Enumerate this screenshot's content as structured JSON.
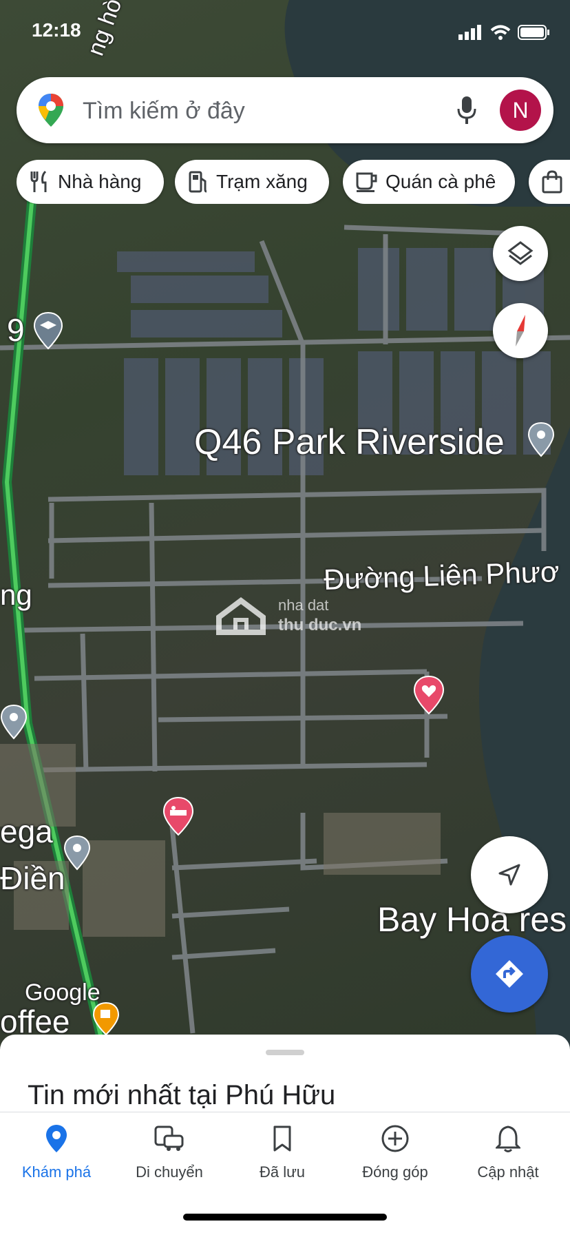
{
  "status_bar": {
    "time": "12:18"
  },
  "search": {
    "placeholder": "Tìm kiếm ở đây",
    "avatar_letter": "N"
  },
  "chips": [
    {
      "label": "Nhà hàng",
      "icon": "restaurant-icon"
    },
    {
      "label": "Trạm xăng",
      "icon": "gas-station-icon"
    },
    {
      "label": "Quán cà phê",
      "icon": "coffee-icon"
    },
    {
      "label": "",
      "icon": "shopping-bag-icon"
    }
  ],
  "map_labels": {
    "park": "Q46 Park Riverside",
    "street": "Đường Liên Phươ",
    "resort": "Bay Hoa res",
    "watermark_top": "nha dat",
    "watermark_bottom": "thu duc.vn",
    "google": "Google",
    "left_1": "9",
    "left_2": "ng",
    "left_3": "ega",
    "left_4": "Điền",
    "left_5": "offee",
    "road_top": "ng hò"
  },
  "bottom_sheet": {
    "title": "Tin mới nhất tại Phú Hữu"
  },
  "nav": [
    {
      "label": "Khám phá",
      "active": true,
      "icon": "explore-pin-icon"
    },
    {
      "label": "Di chuyển",
      "active": false,
      "icon": "commute-icon"
    },
    {
      "label": "Đã lưu",
      "active": false,
      "icon": "bookmark-icon"
    },
    {
      "label": "Đóng góp",
      "active": false,
      "icon": "add-circle-icon"
    },
    {
      "label": "Cập nhật",
      "active": false,
      "icon": "bell-icon"
    }
  ],
  "colors": {
    "accent": "#1a73e8",
    "avatar": "#b3134a",
    "directions": "#3367d6",
    "pin_pink": "#e8496a"
  }
}
